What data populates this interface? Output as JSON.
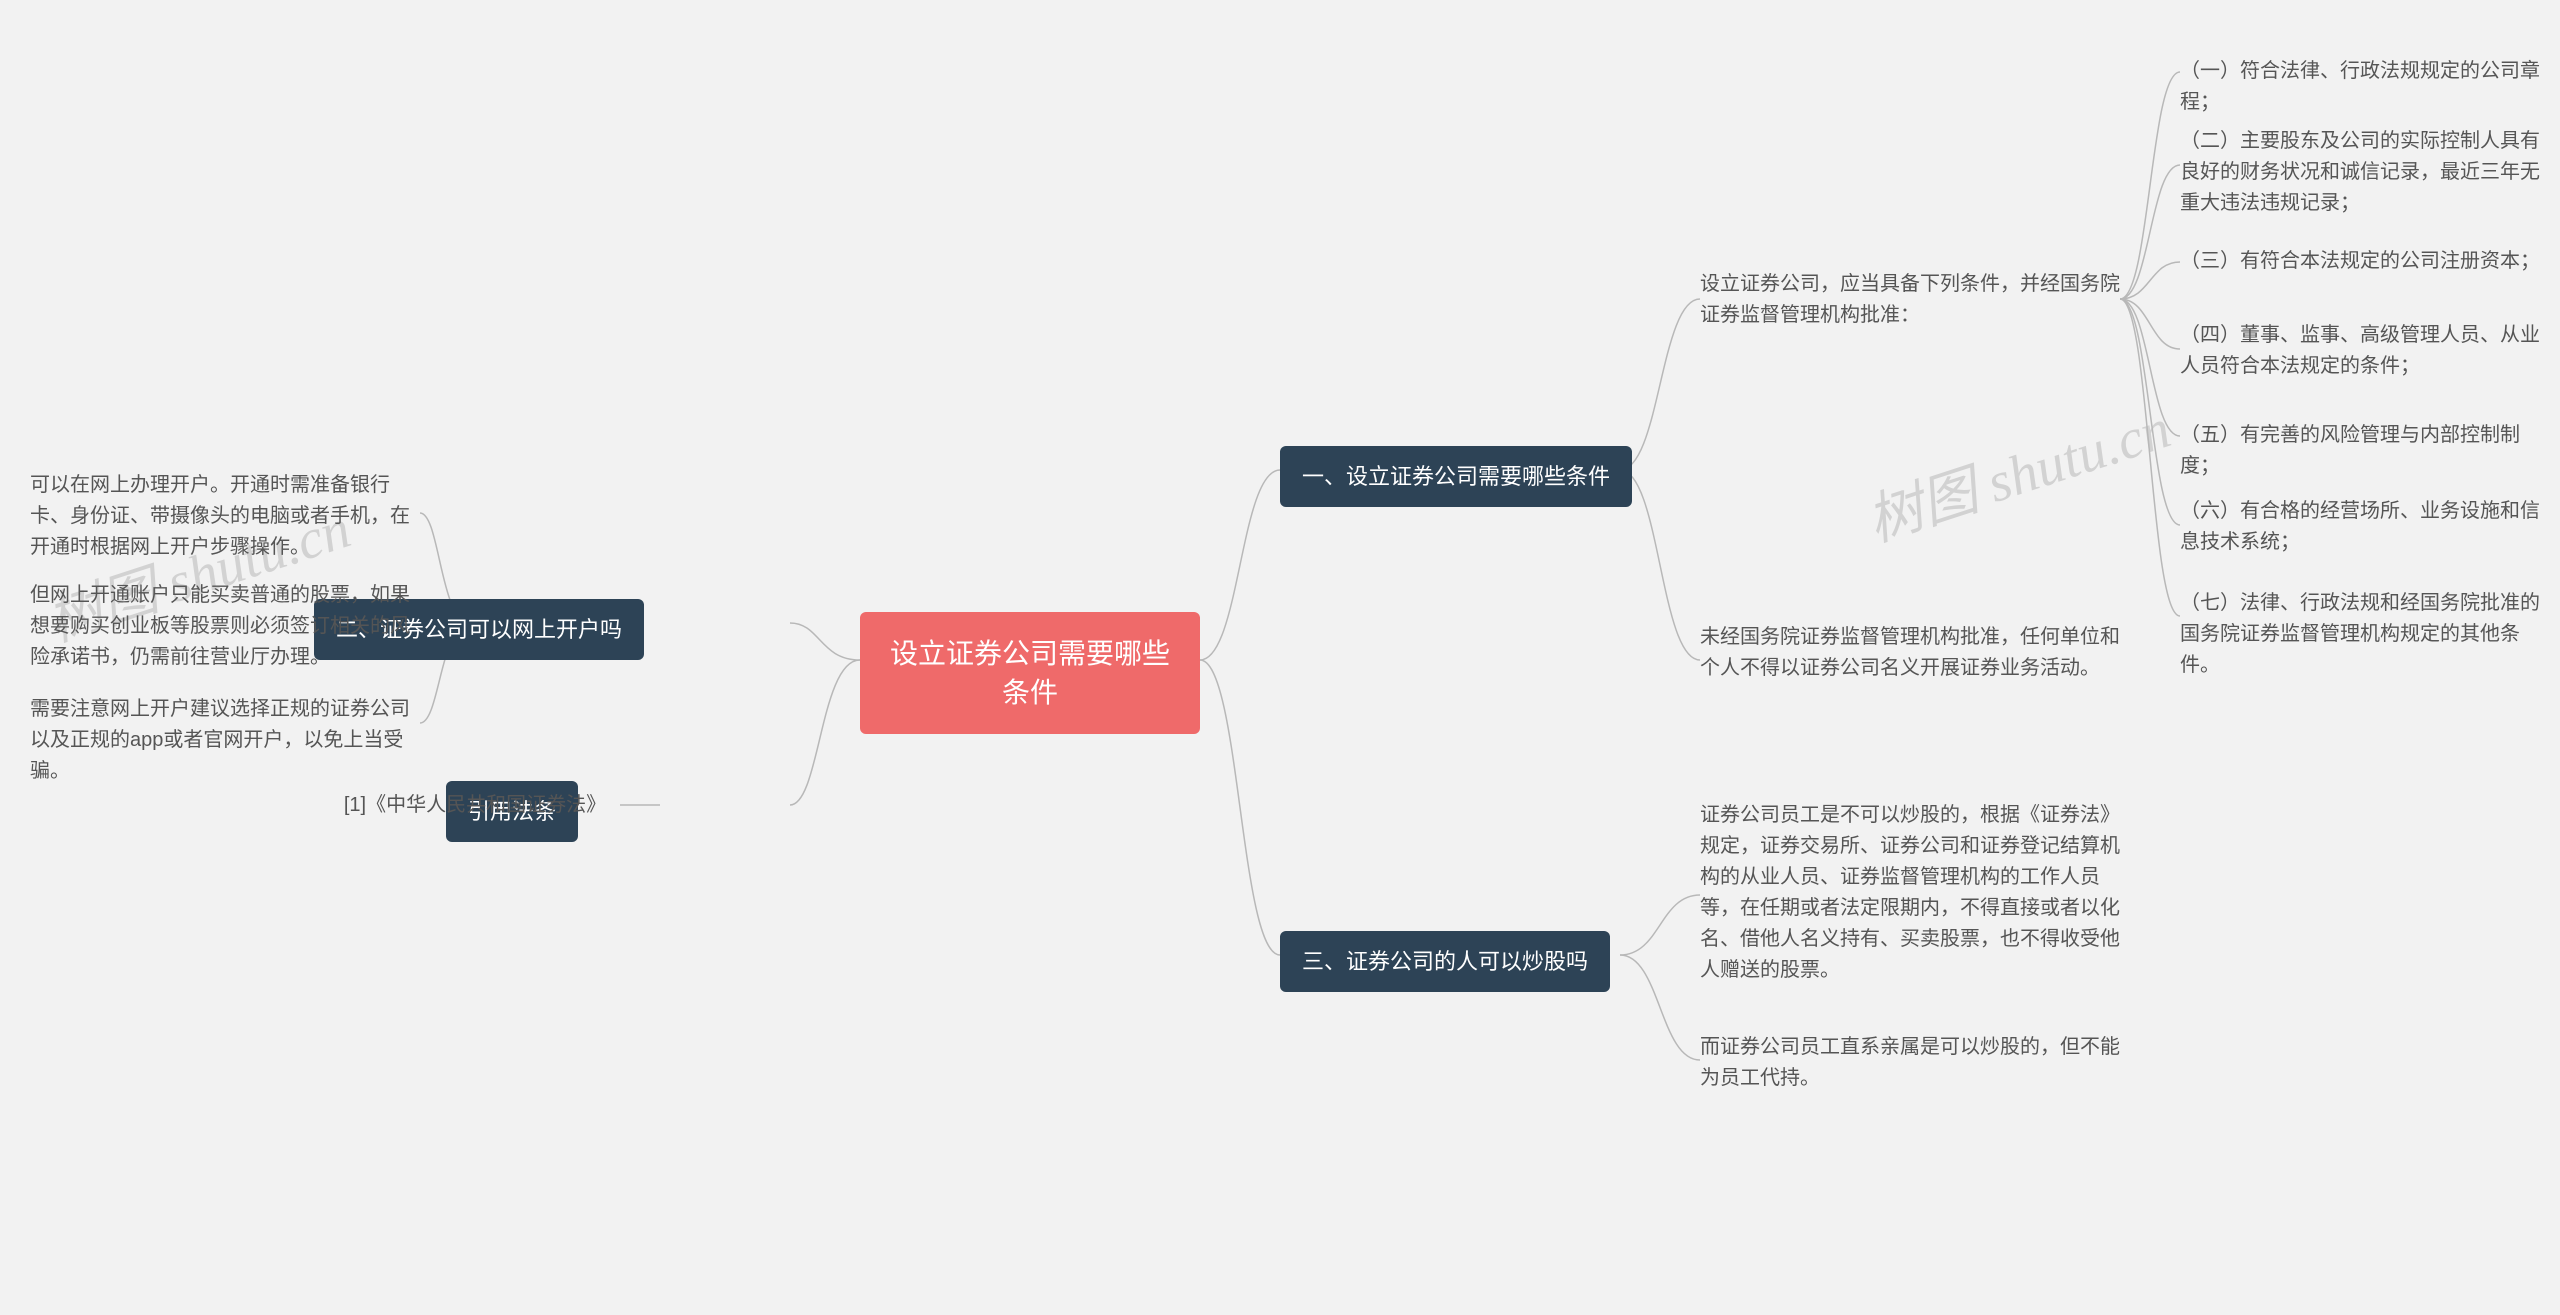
{
  "root": {
    "title": "设立证券公司需要哪些条件"
  },
  "branches": {
    "b1": {
      "label": "一、设立证券公司需要哪些条件",
      "children": {
        "c1": {
          "text": "设立证券公司，应当具备下列条件，并经国务院证券监督管理机构批准：",
          "subs": {
            "s1": "（一）符合法律、行政法规规定的公司章程；",
            "s2": "（二）主要股东及公司的实际控制人具有良好的财务状况和诚信记录，最近三年无重大违法违规记录；",
            "s3": "（三）有符合本法规定的公司注册资本；",
            "s4": "（四）董事、监事、高级管理人员、从业人员符合本法规定的条件；",
            "s5": "（五）有完善的风险管理与内部控制制度；",
            "s6": "（六）有合格的经营场所、业务设施和信息技术系统；",
            "s7": "（七）法律、行政法规和经国务院批准的国务院证券监督管理机构规定的其他条件。"
          }
        },
        "c2": {
          "text": "未经国务院证券监督管理机构批准，任何单位和个人不得以证券公司名义开展证券业务活动。"
        }
      }
    },
    "b2": {
      "label": "二、证券公司可以网上开户吗",
      "children": {
        "c1": "可以在网上办理开户。开通时需准备银行卡、身份证、带摄像头的电脑或者手机，在开通时根据网上开户步骤操作。",
        "c2": "但网上开通账户只能买卖普通的股票，如果想要购买创业板等股票则必须签订相关的风险承诺书，仍需前往营业厅办理。",
        "c3": "需要注意网上开户建议选择正规的证券公司以及正规的app或者官网开户，以免上当受骗。"
      }
    },
    "b3": {
      "label": "三、证券公司的人可以炒股吗",
      "children": {
        "c1": "证券公司员工是不可以炒股的，根据《证券法》规定，证券交易所、证券公司和证券登记结算机构的从业人员、证券监督管理机构的工作人员等，在任期或者法定限期内，不得直接或者以化名、借他人名义持有、买卖股票，也不得收受他人赠送的股票。",
        "c2": "而证券公司员工直系亲属是可以炒股的，但不能为员工代持。"
      }
    },
    "b4": {
      "label": "引用法条",
      "children": {
        "c1": "[1]《中华人民共和国证券法》"
      }
    }
  },
  "watermarks": {
    "w1": "树图 shutu.cn",
    "w2": "树图 shutu.cn"
  }
}
